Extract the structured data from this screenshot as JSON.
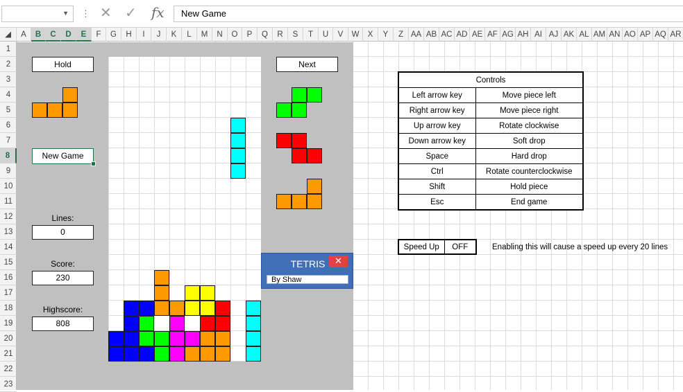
{
  "formula_bar": {
    "name_box": "",
    "cancel_icon": "✕",
    "enter_icon": "✓",
    "fx_label": "fx",
    "formula": "New Game"
  },
  "columns": [
    "A",
    "B",
    "C",
    "D",
    "E",
    "F",
    "G",
    "H",
    "I",
    "J",
    "K",
    "L",
    "M",
    "N",
    "O",
    "P",
    "Q",
    "R",
    "S",
    "T",
    "U",
    "V",
    "W",
    "X",
    "Y",
    "Z",
    "AA",
    "AB",
    "AC",
    "AD",
    "AE",
    "AF",
    "AG",
    "AH",
    "AI",
    "AJ",
    "AK",
    "AL",
    "AM",
    "AN",
    "AO",
    "AP",
    "AQ",
    "AR"
  ],
  "selected_columns": [
    "B",
    "C",
    "D",
    "E"
  ],
  "rows": [
    "1",
    "2",
    "3",
    "4",
    "5",
    "6",
    "7",
    "8",
    "9",
    "10",
    "11",
    "12",
    "13",
    "14",
    "15",
    "16",
    "17",
    "18",
    "19",
    "20",
    "21",
    "22",
    "23"
  ],
  "selected_row": "8",
  "game": {
    "hold_label": "Hold",
    "next_label": "Next",
    "new_game_label": "New Game",
    "lines_label": "Lines:",
    "lines_value": "0",
    "score_label": "Score:",
    "score_value": "230",
    "highscore_label": "Highscore:",
    "highscore_value": "808",
    "colors": {
      "orange": "#ff9900",
      "green": "#00ff00",
      "red": "#ff0000",
      "cyan": "#00ffff",
      "blue": "#0000ff",
      "yellow": "#ffff00",
      "magenta": "#ff00ff",
      "panel": "#c0c0c0"
    },
    "hold_piece": {
      "color": "orange",
      "cells": [
        [
          0,
          2
        ],
        [
          1,
          0
        ],
        [
          1,
          1
        ],
        [
          1,
          2
        ]
      ]
    },
    "next_pieces": [
      {
        "color": "green",
        "cells": [
          [
            0,
            1
          ],
          [
            0,
            2
          ],
          [
            1,
            0
          ],
          [
            1,
            1
          ]
        ]
      },
      {
        "color": "red",
        "cells": [
          [
            0,
            0
          ],
          [
            0,
            1
          ],
          [
            1,
            1
          ],
          [
            1,
            2
          ]
        ]
      },
      {
        "color": "orange",
        "cells": [
          [
            0,
            2
          ],
          [
            1,
            0
          ],
          [
            1,
            1
          ],
          [
            1,
            2
          ]
        ]
      }
    ],
    "board": {
      "cols": 10,
      "rows": 20,
      "cells": [
        {
          "r": 4,
          "c": 8,
          "color": "cyan"
        },
        {
          "r": 5,
          "c": 8,
          "color": "cyan"
        },
        {
          "r": 6,
          "c": 8,
          "color": "cyan"
        },
        {
          "r": 7,
          "c": 8,
          "color": "cyan"
        },
        {
          "r": 14,
          "c": 3,
          "color": "orange"
        },
        {
          "r": 15,
          "c": 3,
          "color": "orange"
        },
        {
          "r": 15,
          "c": 5,
          "color": "yellow"
        },
        {
          "r": 15,
          "c": 6,
          "color": "yellow"
        },
        {
          "r": 16,
          "c": 1,
          "color": "blue"
        },
        {
          "r": 16,
          "c": 2,
          "color": "blue"
        },
        {
          "r": 16,
          "c": 3,
          "color": "orange"
        },
        {
          "r": 16,
          "c": 4,
          "color": "orange"
        },
        {
          "r": 16,
          "c": 5,
          "color": "yellow"
        },
        {
          "r": 16,
          "c": 6,
          "color": "yellow"
        },
        {
          "r": 16,
          "c": 7,
          "color": "red"
        },
        {
          "r": 16,
          "c": 9,
          "color": "cyan"
        },
        {
          "r": 17,
          "c": 1,
          "color": "blue"
        },
        {
          "r": 17,
          "c": 2,
          "color": "green"
        },
        {
          "r": 17,
          "c": 4,
          "color": "magenta"
        },
        {
          "r": 17,
          "c": 6,
          "color": "red"
        },
        {
          "r": 17,
          "c": 7,
          "color": "red"
        },
        {
          "r": 17,
          "c": 9,
          "color": "cyan"
        },
        {
          "r": 18,
          "c": 0,
          "color": "blue"
        },
        {
          "r": 18,
          "c": 1,
          "color": "blue"
        },
        {
          "r": 18,
          "c": 2,
          "color": "green"
        },
        {
          "r": 18,
          "c": 3,
          "color": "green"
        },
        {
          "r": 18,
          "c": 4,
          "color": "magenta"
        },
        {
          "r": 18,
          "c": 5,
          "color": "magenta"
        },
        {
          "r": 18,
          "c": 6,
          "color": "orange"
        },
        {
          "r": 18,
          "c": 7,
          "color": "orange"
        },
        {
          "r": 18,
          "c": 9,
          "color": "cyan"
        },
        {
          "r": 19,
          "c": 0,
          "color": "blue"
        },
        {
          "r": 19,
          "c": 1,
          "color": "blue"
        },
        {
          "r": 19,
          "c": 2,
          "color": "blue"
        },
        {
          "r": 19,
          "c": 3,
          "color": "green"
        },
        {
          "r": 19,
          "c": 4,
          "color": "magenta"
        },
        {
          "r": 19,
          "c": 5,
          "color": "orange"
        },
        {
          "r": 19,
          "c": 6,
          "color": "orange"
        },
        {
          "r": 19,
          "c": 7,
          "color": "orange"
        },
        {
          "r": 19,
          "c": 9,
          "color": "cyan"
        }
      ]
    }
  },
  "dialog": {
    "title": "TETRIS",
    "close_icon": "✕",
    "field_text": "By Shaw"
  },
  "controls": {
    "header": "Controls",
    "rows": [
      {
        "key": "Left arrow key",
        "action": "Move piece left"
      },
      {
        "key": "Right arrow key",
        "action": "Move piece right"
      },
      {
        "key": "Up arrow key",
        "action": "Rotate clockwise"
      },
      {
        "key": "Down arrow key",
        "action": "Soft drop"
      },
      {
        "key": "Space",
        "action": "Hard drop"
      },
      {
        "key": "Ctrl",
        "action": "Rotate counterclockwise"
      },
      {
        "key": "Shift",
        "action": "Hold piece"
      },
      {
        "key": "Esc",
        "action": "End game"
      }
    ]
  },
  "speed_up": {
    "label": "Speed Up",
    "value": "OFF",
    "note": "Enabling this will cause a speed up every 20 lines"
  }
}
